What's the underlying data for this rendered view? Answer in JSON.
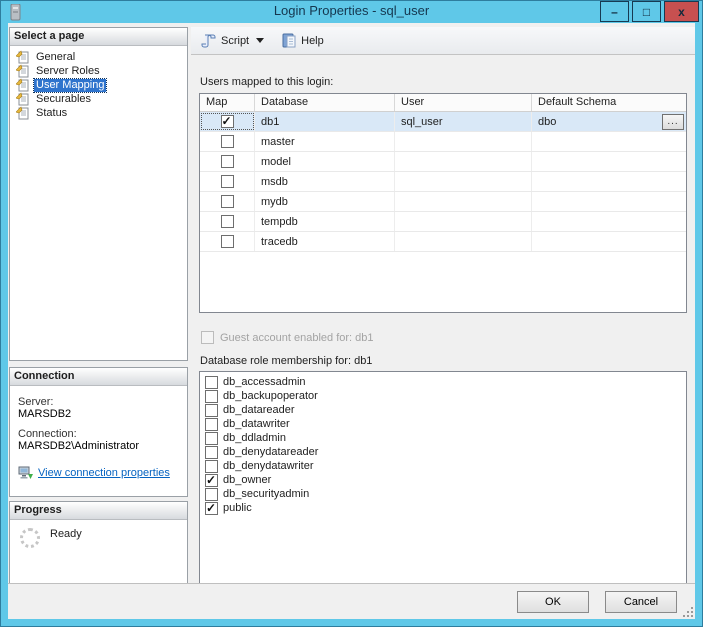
{
  "window": {
    "title": "Login Properties - sql_user",
    "controls": {
      "minimize": "–",
      "maximize": "□",
      "close": "x"
    }
  },
  "sidebar": {
    "select_page": {
      "header": "Select a page",
      "items": [
        {
          "label": "General",
          "selected": false
        },
        {
          "label": "Server Roles",
          "selected": false
        },
        {
          "label": "User Mapping",
          "selected": true
        },
        {
          "label": "Securables",
          "selected": false
        },
        {
          "label": "Status",
          "selected": false
        }
      ]
    },
    "connection": {
      "header": "Connection",
      "server_label": "Server:",
      "server_value": "MARSDB2",
      "connection_label": "Connection:",
      "connection_value": "MARSDB2\\Administrator",
      "link_label": "View connection properties"
    },
    "progress": {
      "header": "Progress",
      "status": "Ready"
    }
  },
  "toolbar": {
    "script_label": "Script",
    "help_label": "Help"
  },
  "main": {
    "users_table": {
      "label": "Users mapped to this login:",
      "columns": [
        "Map",
        "Database",
        "User",
        "Default Schema"
      ],
      "ellipsis_label": "...",
      "rows": [
        {
          "map": true,
          "database": "db1",
          "user": "sql_user",
          "default_schema": "dbo",
          "selected": true
        },
        {
          "map": false,
          "database": "master",
          "user": "",
          "default_schema": "",
          "selected": false
        },
        {
          "map": false,
          "database": "model",
          "user": "",
          "default_schema": "",
          "selected": false
        },
        {
          "map": false,
          "database": "msdb",
          "user": "",
          "default_schema": "",
          "selected": false
        },
        {
          "map": false,
          "database": "mydb",
          "user": "",
          "default_schema": "",
          "selected": false
        },
        {
          "map": false,
          "database": "tempdb",
          "user": "",
          "default_schema": "",
          "selected": false
        },
        {
          "map": false,
          "database": "tracedb",
          "user": "",
          "default_schema": "",
          "selected": false
        }
      ]
    },
    "guest_account": {
      "label": "Guest account enabled for: db1",
      "checked": false,
      "enabled": false
    },
    "roles": {
      "label": "Database role membership for: db1",
      "items": [
        {
          "label": "db_accessadmin",
          "checked": false
        },
        {
          "label": "db_backupoperator",
          "checked": false
        },
        {
          "label": "db_datareader",
          "checked": false
        },
        {
          "label": "db_datawriter",
          "checked": false
        },
        {
          "label": "db_ddladmin",
          "checked": false
        },
        {
          "label": "db_denydatareader",
          "checked": false
        },
        {
          "label": "db_denydatawriter",
          "checked": false
        },
        {
          "label": "db_owner",
          "checked": true
        },
        {
          "label": "db_securityadmin",
          "checked": false
        },
        {
          "label": "public",
          "checked": true
        }
      ]
    }
  },
  "footer": {
    "ok_label": "OK",
    "cancel_label": "Cancel"
  },
  "colors": {
    "titlebar": "#5fc8e8",
    "close_button": "#c75050",
    "selection": "#2f74cd",
    "row_selection": "#d9e8f7",
    "link": "#0563c1"
  }
}
